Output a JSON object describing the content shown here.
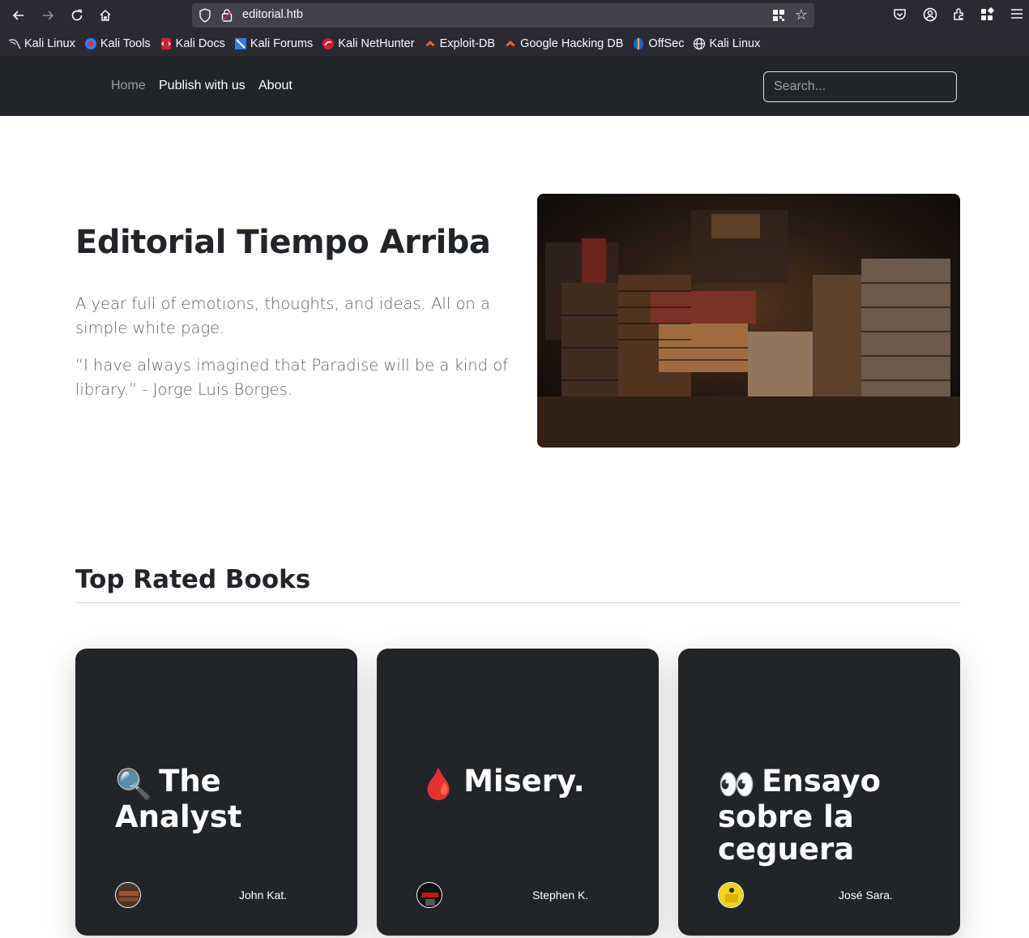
{
  "browser": {
    "url": "editorial.htb",
    "bookmarks": [
      {
        "label": "Kali Linux",
        "icon": "kali-dragon-icon"
      },
      {
        "label": "Kali Tools",
        "icon": "kali-tools-icon"
      },
      {
        "label": "Kali Docs",
        "icon": "kali-docs-icon"
      },
      {
        "label": "Kali Forums",
        "icon": "kali-forums-icon"
      },
      {
        "label": "Kali NetHunter",
        "icon": "kali-nethunter-icon"
      },
      {
        "label": "Exploit-DB",
        "icon": "exploit-db-icon"
      },
      {
        "label": "Google Hacking DB",
        "icon": "ghdb-icon"
      },
      {
        "label": "OffSec",
        "icon": "offsec-icon"
      },
      {
        "label": "Kali Linux",
        "icon": "globe-icon"
      }
    ]
  },
  "nav": {
    "home": "Home",
    "publish": "Publish with us",
    "about": "About",
    "search_placeholder": "Search..."
  },
  "hero": {
    "title": "Editorial Tiempo Arriba",
    "tagline": "A year full of emotions, thoughts, and ideas. All on a simple white page.",
    "quote": "“I have always imagined that Paradise will be a kind of library.” - Jorge Luis Borges."
  },
  "books_section": {
    "title": "Top Rated Books",
    "cards": [
      {
        "emoji": "🔍",
        "title": "The Analyst",
        "author": "John Kat."
      },
      {
        "emoji": "🩸",
        "title": "Misery.",
        "author": "Stephen K."
      },
      {
        "emoji": "👀",
        "title": "Ensayo sobre la ceguera",
        "author": "José Sara."
      }
    ]
  },
  "colors": {
    "navbar_bg": "#212529",
    "card_bg": "#212529",
    "browser_bg": "#2b2a33"
  }
}
